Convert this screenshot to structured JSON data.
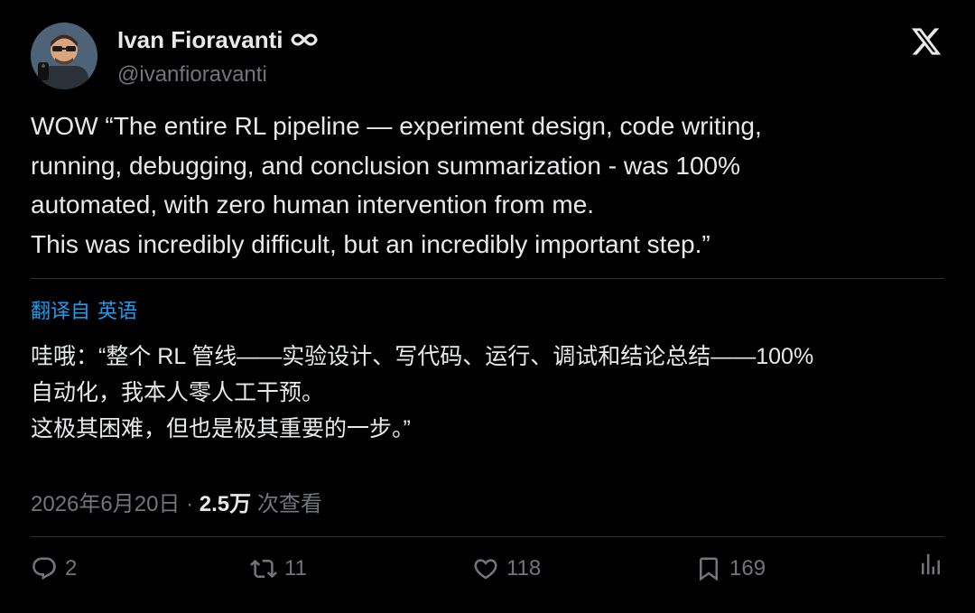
{
  "author": {
    "display_name": "Ivan Fioravanti",
    "handle": "@ivanfioravanti",
    "badge_icon": "infinity-icon",
    "avatar_icon": "avatar-photo"
  },
  "logo": "x-logo",
  "tweet": {
    "lines": [
      "WOW “The entire RL pipeline — experiment design, code writing,",
      "running, debugging, and conclusion summarization - was 100%",
      "automated, with zero human intervention from me.",
      "This was incredibly difficult, but an incredibly important step.”"
    ]
  },
  "translation": {
    "label": "翻译自",
    "language": "英语",
    "lines": [
      "哇哦：“整个 RL 管线——实验设计、写代码、运行、调试和结论总结——100%",
      "自动化，我本人零人工干预。",
      "这极其困难，但也是极其重要的一步。”"
    ]
  },
  "meta": {
    "date": "2026年6月20日",
    "separator": "·",
    "views_count": "2.5万",
    "views_label": "次查看"
  },
  "actions": {
    "replies": "2",
    "reposts": "11",
    "likes": "118",
    "bookmarks": "169"
  },
  "colors": {
    "background": "#000000",
    "text": "#e7e9ea",
    "muted": "#71767b",
    "link": "#1d9bf0",
    "divider": "#2f3336"
  }
}
